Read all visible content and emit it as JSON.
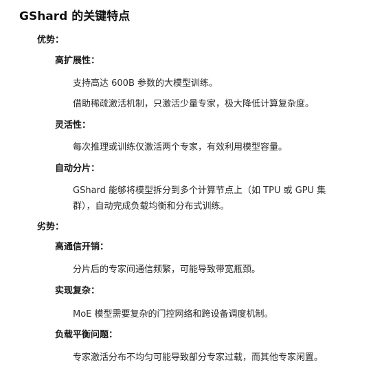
{
  "title": "GShard 的关键特点",
  "advantages": {
    "label": "优势：",
    "items": [
      {
        "heading": "高扩展性：",
        "paragraphs": [
          "支持高达 600B 参数的大模型训练。",
          "借助稀疏激活机制，只激活少量专家，极大降低计算复杂度。"
        ]
      },
      {
        "heading": "灵活性：",
        "paragraphs": [
          "每次推理或训练仅激活两个专家，有效利用模型容量。"
        ]
      },
      {
        "heading": "自动分片：",
        "paragraph_lines": [
          "GShard 能够将模型拆分到多个计算节点上（如 TPU 或 GPU 集",
          "群），自动完成负载均衡和分布式训练。"
        ]
      }
    ]
  },
  "disadvantages": {
    "label": "劣势：",
    "items": [
      {
        "heading": "高通信开销：",
        "paragraphs": [
          "分片后的专家间通信频繁，可能导致带宽瓶颈。"
        ]
      },
      {
        "heading": "实现复杂：",
        "paragraphs": [
          "MoE 模型需要复杂的门控网络和跨设备调度机制。"
        ]
      },
      {
        "heading": "负载平衡问题：",
        "paragraphs": [
          "专家激活分布不均匀可能导致部分专家过载，而其他专家闲置。"
        ]
      }
    ]
  }
}
